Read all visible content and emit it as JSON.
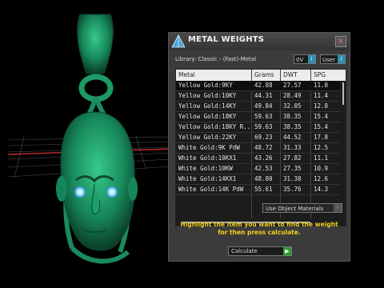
{
  "panel": {
    "title": "METAL WEIGHTS",
    "close_glyph": "x",
    "library_label": "Library: Classic - (Fast)-Metal",
    "dropdown_a": "0V",
    "dropdown_b": "User",
    "dropdown_arrow": "i",
    "columns": [
      "Metal",
      "Grams",
      "DWT",
      "SPG"
    ],
    "rows": [
      [
        "Yellow Gold:9KY",
        "42.88",
        "27.57",
        "11.0"
      ],
      [
        "Yellow Gold:10KY",
        "44.31",
        "28.49",
        "11.4"
      ],
      [
        "Yellow Gold:14KY",
        "49.84",
        "32.05",
        "12.8"
      ],
      [
        "Yellow Gold:18KY",
        "59.63",
        "38.35",
        "15.4"
      ],
      [
        "Yellow Gold:18KY R...",
        "59.63",
        "38.35",
        "15.4"
      ],
      [
        "Yellow Gold:22KY",
        "69.23",
        "44.52",
        "17.8"
      ],
      [
        "White Gold:9K PdW",
        "48.72",
        "31.33",
        "12.5"
      ],
      [
        "White Gold:10KX1",
        "43.26",
        "27.82",
        "11.1"
      ],
      [
        "White Gold:10KW",
        "42.53",
        "27.35",
        "10.9"
      ],
      [
        "White Gold:14KX1",
        "48.80",
        "31.38",
        "12.6"
      ],
      [
        "White Gold:14K PdW",
        "55.61",
        "35.76",
        "14.3"
      ]
    ],
    "use_object_materials": "Use Object Materials",
    "hint": "Highlight the item you want to find the weight for then press calculate.",
    "calculate": "Calculate",
    "calculate_arrow": "▶",
    "dropdown_arrow_small": "◦"
  },
  "colors": {
    "pendant": "#1f9a6a",
    "hint_text": "#f4d21c",
    "grid_red": "#b02828"
  },
  "icons": {
    "title": "tetrahedron-logo-icon",
    "close": "close-icon"
  }
}
